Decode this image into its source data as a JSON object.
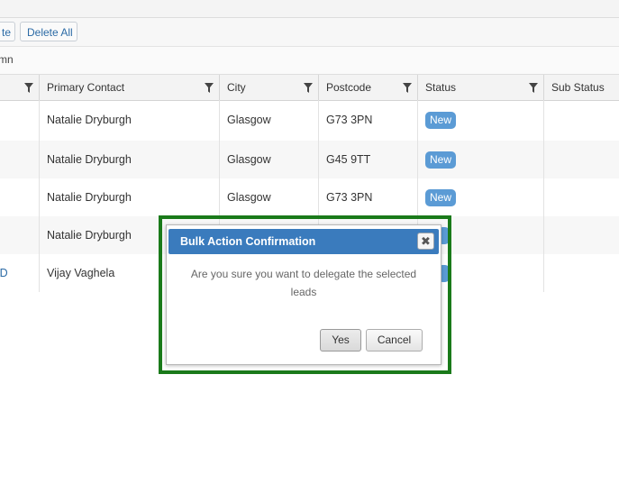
{
  "toolbar": {
    "partial_button_label": "te",
    "delete_all_label": "Delete All"
  },
  "groupbar": {
    "text": "mn"
  },
  "columns": [
    {
      "label": "",
      "filter": true
    },
    {
      "label": "Primary Contact",
      "filter": true
    },
    {
      "label": "City",
      "filter": true
    },
    {
      "label": "Postcode",
      "filter": true
    },
    {
      "label": "Status",
      "filter": true
    },
    {
      "label": "Sub Status",
      "filter": false
    }
  ],
  "rows": [
    {
      "lead": "",
      "contact": "Natalie Dryburgh",
      "city": "Glasgow",
      "postcode": "G73 3PN",
      "status": "New"
    },
    {
      "lead": "",
      "contact": "Natalie Dryburgh",
      "city": "Glasgow",
      "postcode": "G45 9TT",
      "status": "New"
    },
    {
      "lead": "",
      "contact": "Natalie Dryburgh",
      "city": "Glasgow",
      "postcode": "G73 3PN",
      "status": "New"
    },
    {
      "lead": "",
      "contact": "Natalie Dryburgh",
      "city": "",
      "postcode": "",
      "status": ""
    },
    {
      "lead": "TD",
      "contact": "Vijay Vaghela",
      "city": "",
      "postcode": "",
      "status": ""
    }
  ],
  "dialog": {
    "title": "Bulk Action Confirmation",
    "message": "Are you sure you want to delegate the selected leads",
    "yes_label": "Yes",
    "cancel_label": "Cancel",
    "close_glyph": "✖"
  },
  "colors": {
    "accent": "#3a7bbd",
    "badge": "#5b9bd5",
    "focus_frame": "#1a7a1a",
    "link": "#2b6aa5"
  }
}
